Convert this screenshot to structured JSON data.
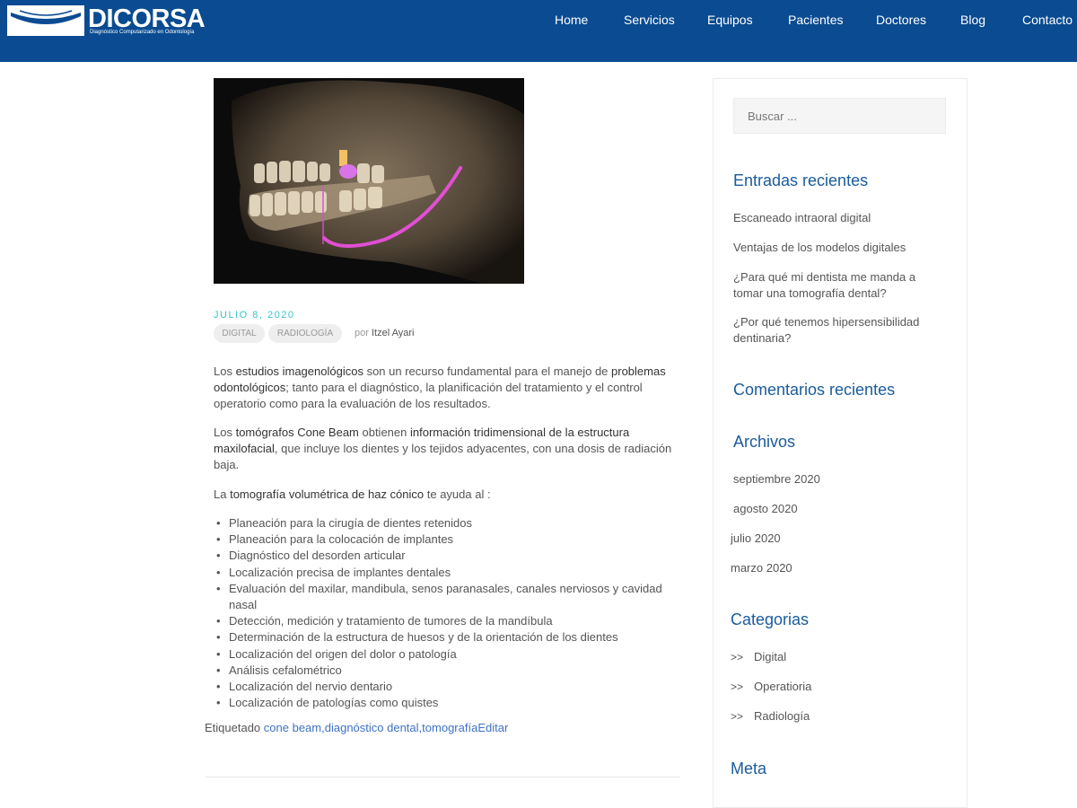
{
  "header": {
    "logo_text": "DICORSA",
    "logo_subtitle": "Diagnóstico Computarizado en Odontología",
    "nav": [
      "Home",
      "Servicios",
      "Equipos",
      "Pacientes",
      "Doctores",
      "Blog",
      "Contacto"
    ]
  },
  "post": {
    "date": "JULIO 8, 2020",
    "categories": [
      "DIGITAL",
      "RADIOLOGÍA"
    ],
    "by_label": "por",
    "author": "Itzel Ayari",
    "p1": {
      "t1": "Los ",
      "b1": "estudios imagenológicos",
      "t2": " son un recurso fundamental para el manejo de ",
      "b2": "problemas odontológicos",
      "t3": "; tanto para el diagnóstico, la planificación del tratamiento y el control operatorio como para la evaluación de los resultados."
    },
    "p2": {
      "t1": "Los ",
      "b1": "tomógrafos Cone Beam",
      "t2": " obtienen ",
      "b2": "información tridimensional de la estructura maxilofacial",
      "t3": ", que incluye los dientes y los tejidos adyacentes, con una dosis de radiación baja."
    },
    "p3": {
      "t1": "La ",
      "b1": "tomografía volumétrica de haz cónico",
      "t2": " te ayuda al :"
    },
    "bullets": [
      "Planeación para la cirugía de dientes retenidos",
      "Planeación para la colocación de implantes",
      "Diagnóstico del desorden articular",
      " Localización precisa de implantes dentales",
      "Evaluación del maxilar, mandibula, senos paranasales, canales nerviosos y cavidad nasal",
      "Detección, medición y tratamiento de tumores de la mandíbula",
      "Determinación de la estructura de huesos y de la orientación de los dientes",
      "Localización del origen del dolor o patología",
      "Análisis cefalométrico",
      "Localización del nervio dentario",
      "Localización de patologías como quistes"
    ],
    "tagged_label": "Etiquetado ",
    "tags": [
      "cone beam",
      "diagnóstico dental",
      "tomografía"
    ],
    "edit_label": "Editar"
  },
  "sidebar": {
    "search_placeholder": "Buscar ...",
    "recent_posts_title": "Entradas recientes",
    "recent_posts": [
      "Escaneado intraoral digital",
      "Ventajas de los modelos digitales",
      "¿Para qué mi dentista me manda a tomar una tomografía dental?",
      "¿Por qué tenemos hipersensibilidad dentinaria?"
    ],
    "recent_comments_title": "Comentarios recientes",
    "archives_title": "Archivos",
    "archives": [
      "septiembre 2020",
      "agosto 2020",
      "julio 2020",
      "marzo 2020"
    ],
    "categories_title": "Categorias",
    "category_marker": ">>",
    "categories": [
      "Digital",
      "Operatioria",
      "Radiología"
    ],
    "meta_title": "Meta"
  },
  "colors": {
    "header_bg": "#0a4b91",
    "date_accent": "#3cc3c9",
    "widget_title": "#1a5b9c",
    "link": "#3f72c4"
  }
}
